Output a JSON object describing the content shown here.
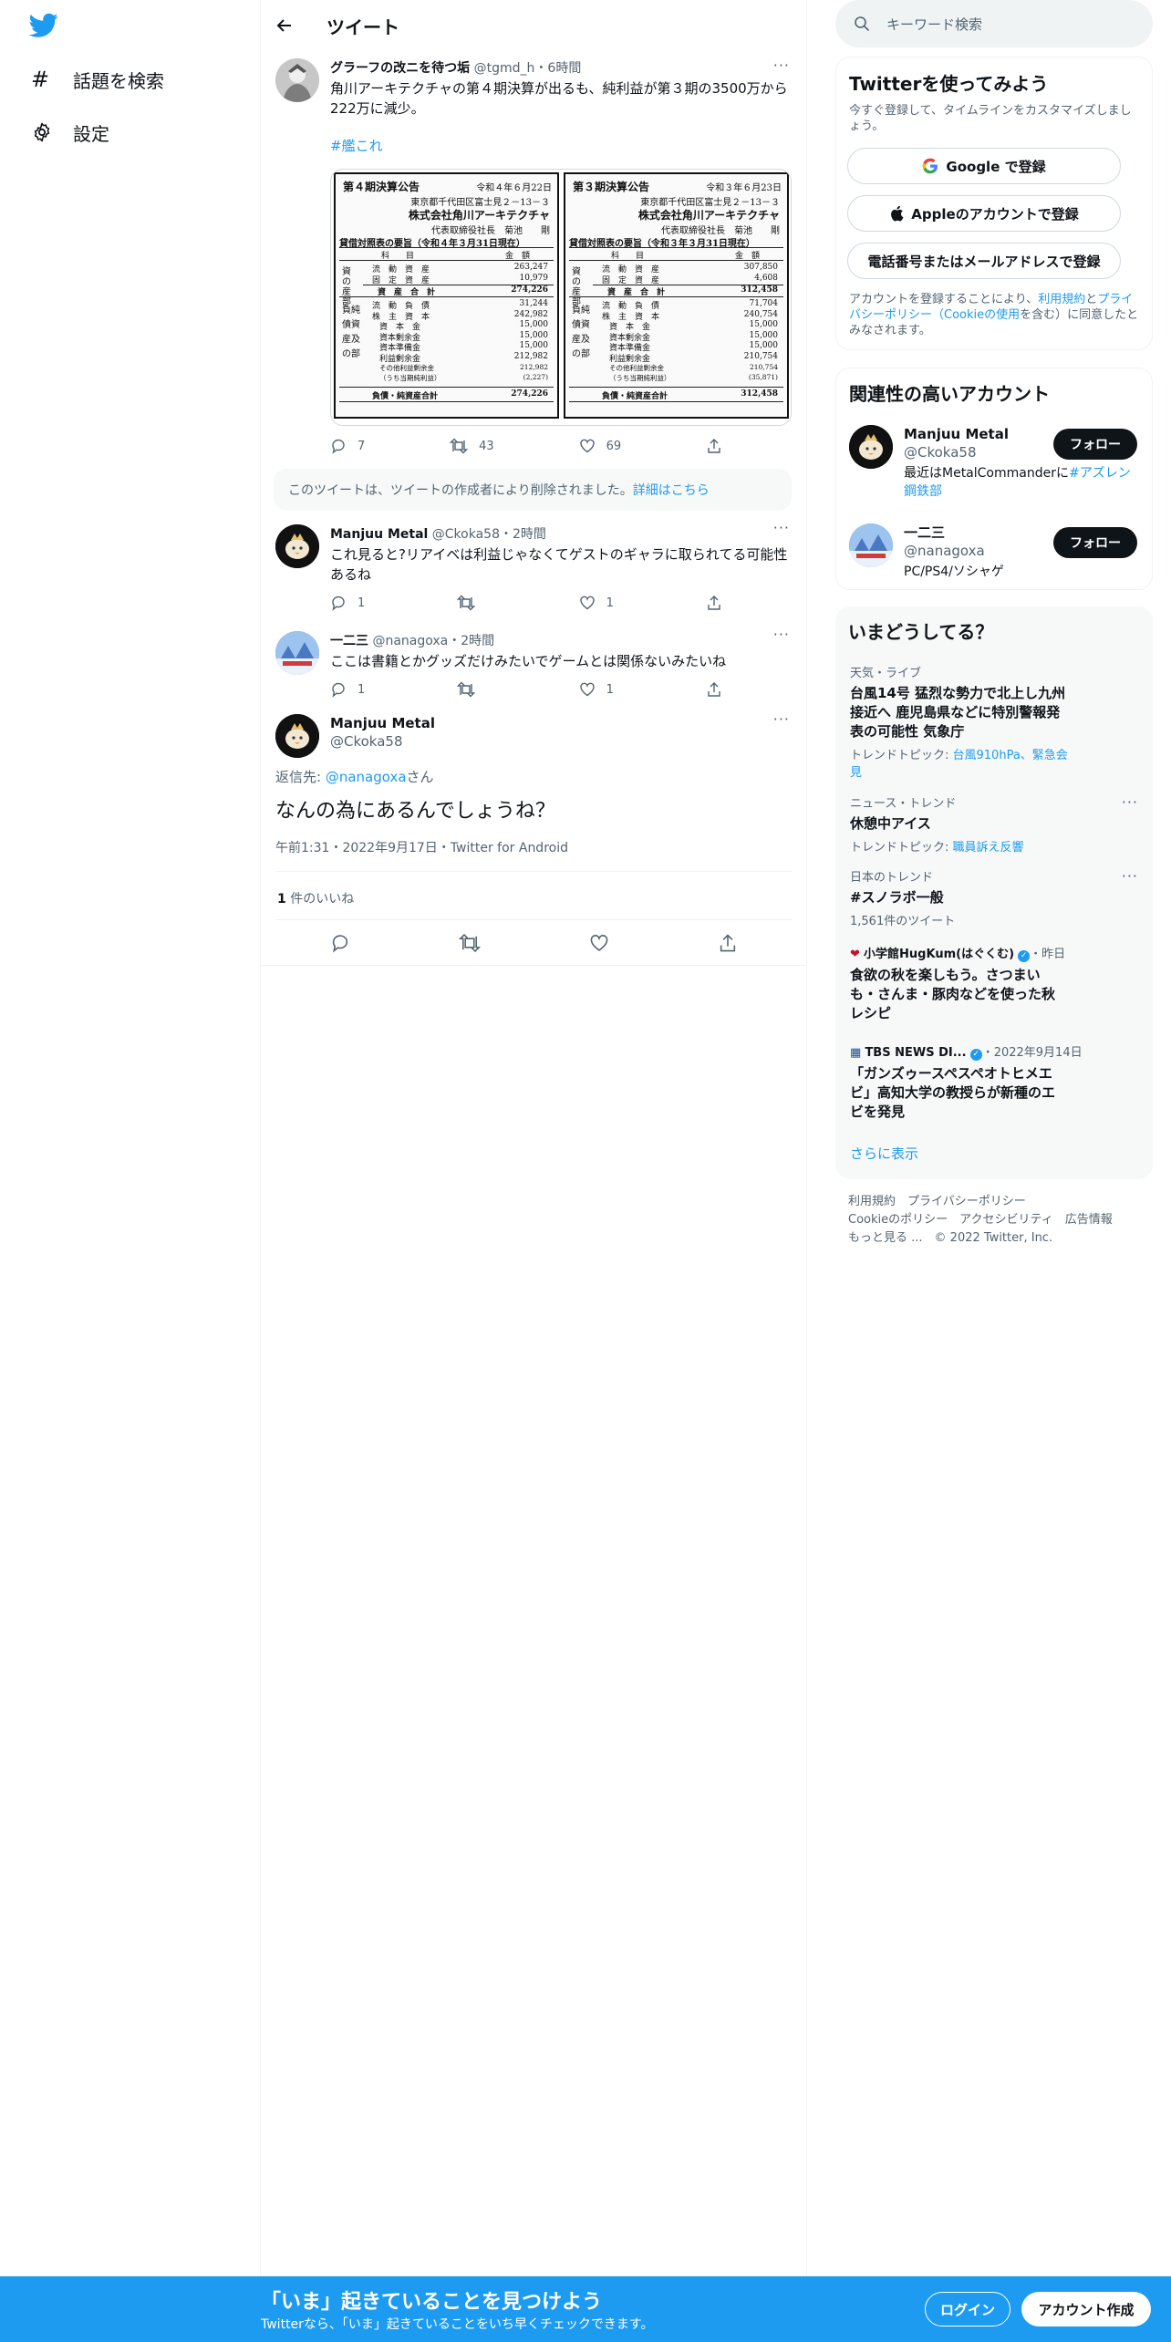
{
  "nav": {
    "explore": "話題を検索",
    "settings": "設定"
  },
  "header": {
    "title": "ツイート"
  },
  "main_tweet": {
    "name": "グラーフの改ニを待つ垢",
    "handle": "@tgmd_h",
    "time": "・6時間",
    "text": "角川アーキテクチャの第４期決算が出るも、純利益が第３期の3500万から222万に減少。",
    "hashtag": "#艦これ",
    "replies": "7",
    "retweets": "43",
    "likes": "69"
  },
  "balance_sheets": [
    {
      "title": "第４期決算公告",
      "date": "令和４年６月22日",
      "address": "東京都千代田区富士見２－13－３",
      "company": "株式会社角川アーキテクチャ",
      "rep": "代表取締役社長　菊池　　剛",
      "heading": "貸借対照表の要旨（令和４年３月31日現在）",
      "col_item": "科　　目",
      "col_amount": "金　額",
      "assets_label": "資の産部",
      "asset_rows": [
        [
          "流　動　資　産",
          "263,247"
        ],
        [
          "固　定　資　産",
          "10,979"
        ]
      ],
      "asset_total": [
        "資　産　合　計",
        "274,226"
      ],
      "liab_label": "負純債資産及の部",
      "liab_rows": [
        [
          "流　動　負　債",
          "31,244"
        ],
        [
          "株　主　資　本",
          "242,982"
        ],
        [
          "資　本　金",
          "15,000"
        ],
        [
          "資本剰余金",
          "15,000"
        ],
        [
          "資本準備金",
          "15,000"
        ],
        [
          "利益剰余金",
          "212,982"
        ],
        [
          "その他利益剰余金",
          "212,982"
        ],
        [
          "（うち当期純利益）",
          "(2,227)"
        ]
      ],
      "liab_total": [
        "負債・純資産合計",
        "274,226"
      ]
    },
    {
      "title": "第３期決算公告",
      "date": "令和３年６月23日",
      "address": "東京都千代田区富士見２－13－３",
      "company": "株式会社角川アーキテクチャ",
      "rep": "代表取締役社長　菊池　　剛",
      "heading": "貸借対照表の要旨（令和３年３月31日現在）",
      "col_item": "科　　目",
      "col_amount": "金　額",
      "assets_label": "資の産部",
      "asset_rows": [
        [
          "流　動　資　産",
          "307,850"
        ],
        [
          "固　定　資　産",
          "4,608"
        ]
      ],
      "asset_total": [
        "資　産　合　計",
        "312,458"
      ],
      "liab_label": "負純債資産及の部",
      "liab_rows": [
        [
          "流　動　負　債",
          "71,704"
        ],
        [
          "株　主　資　本",
          "240,754"
        ],
        [
          "資　本　金",
          "15,000"
        ],
        [
          "資本剰余金",
          "15,000"
        ],
        [
          "資本準備金",
          "15,000"
        ],
        [
          "利益剰余金",
          "210,754"
        ],
        [
          "その他利益剰余金",
          "210,754"
        ],
        [
          "（うち当期純利益）",
          "(35,871)"
        ]
      ],
      "liab_total": [
        "負債・純資産合計",
        "312,458"
      ]
    }
  ],
  "deleted_notice": {
    "text": "このツイートは、ツイートの作成者により削除されました。",
    "link": "詳細はこちら"
  },
  "replies": [
    {
      "name": "Manjuu Metal",
      "handle": "@Ckoka58",
      "time": "・2時間",
      "text": "これ見ると?リアイベは利益じゃなくてゲストのギャラに取られてる可能性あるね",
      "replies": "1",
      "retweets": "",
      "likes": "1"
    },
    {
      "name": "一二三",
      "handle": "@nanagoxa",
      "time": "・2時間",
      "text": "ここは書籍とかグッズだけみたいでゲームとは関係ないみたいね",
      "replies": "1",
      "retweets": "",
      "likes": "1"
    }
  ],
  "focus_tweet": {
    "name": "Manjuu Metal",
    "handle": "@Ckoka58",
    "reply_prefix": "返信先: ",
    "reply_to": "@nanagoxa",
    "reply_suffix": "さん",
    "text": "なんの為にあるんでしょうね？",
    "timestamp": "午前1:31・2022年9月17日・Twitter for Android",
    "likes_count": "1",
    "likes_label": " 件のいいね"
  },
  "search": {
    "placeholder": "キーワード検索"
  },
  "signup": {
    "title": "Twitterを使ってみよう",
    "subtitle": "今すぐ登録して、タイムラインをカスタマイズしましょう。",
    "google": "Google で登録",
    "apple": "Appleのアカウントで登録",
    "phone": "電話番号またはメールアドレスで登録",
    "legal_1": "アカウントを登録することにより、",
    "legal_link1": "利用規約",
    "legal_2": "と",
    "legal_link2": "プライバシーポリシー（Cookieの使用",
    "legal_3": "を含む）に同意したとみなされます。"
  },
  "related": {
    "title": "関連性の高いアカウント",
    "accounts": [
      {
        "name": "Manjuu Metal",
        "handle": "@Ckoka58",
        "bio_1": "最近はMetalCommanderに",
        "bio_link": "#アズレン",
        "bio_2": "鋼鉄部",
        "follow": "フォロー"
      },
      {
        "name": "一二三",
        "handle": "@nanagoxa",
        "bio_1": "PC/PS4/ソシャゲ",
        "bio_link": "",
        "bio_2": "",
        "follow": "フォロー"
      }
    ]
  },
  "trends": {
    "title": "いまどうしてる？",
    "items": [
      {
        "context": "天気・ライブ",
        "name": "台風14号 猛烈な勢力で北上し九州接近へ 鹿児島県などに特別警報発表の可能性 気象庁",
        "topic_label": "トレンドトピック: ",
        "topic": "台風910hPa、緊急会見"
      },
      {
        "context": "ニュース・トレンド",
        "name": "休憩中アイス",
        "topic_label": "トレンドトピック: ",
        "topic": "職員訴え反響"
      },
      {
        "context": "日本のトレンド",
        "name": "#スノラボ一般",
        "count": "1,561件のツイート"
      },
      {
        "source": "小学館HugKum(はぐくむ)",
        "time": "・昨日",
        "name": "食欲の秋を楽しもう。さつまいも・さんま・豚肉などを使った秋レシピ"
      },
      {
        "source": "TBS NEWS DI...",
        "time": "・2022年9月14日",
        "name": "「ガンズゥースペスペオトヒメエビ」高知大学の教授らが新種のエビを発見"
      }
    ],
    "show_more": "さらに表示"
  },
  "footer": {
    "links": [
      "利用規約",
      "プライバシーポリシー",
      "Cookieのポリシー",
      "アクセシビリティ",
      "広告情報",
      "もっと見る ..."
    ],
    "copyright": "© 2022 Twitter, Inc."
  },
  "bottom_bar": {
    "headline": "「いま」起きていることを見つけよう",
    "sub": "Twitterなら、「いま」起きていることをいち早くチェックできます。",
    "login": "ログイン",
    "signup": "アカウント作成"
  },
  "colors": {
    "accent": "#1d9bf0",
    "text": "#0f1419",
    "muted": "#536471",
    "border": "#eff3f4"
  }
}
